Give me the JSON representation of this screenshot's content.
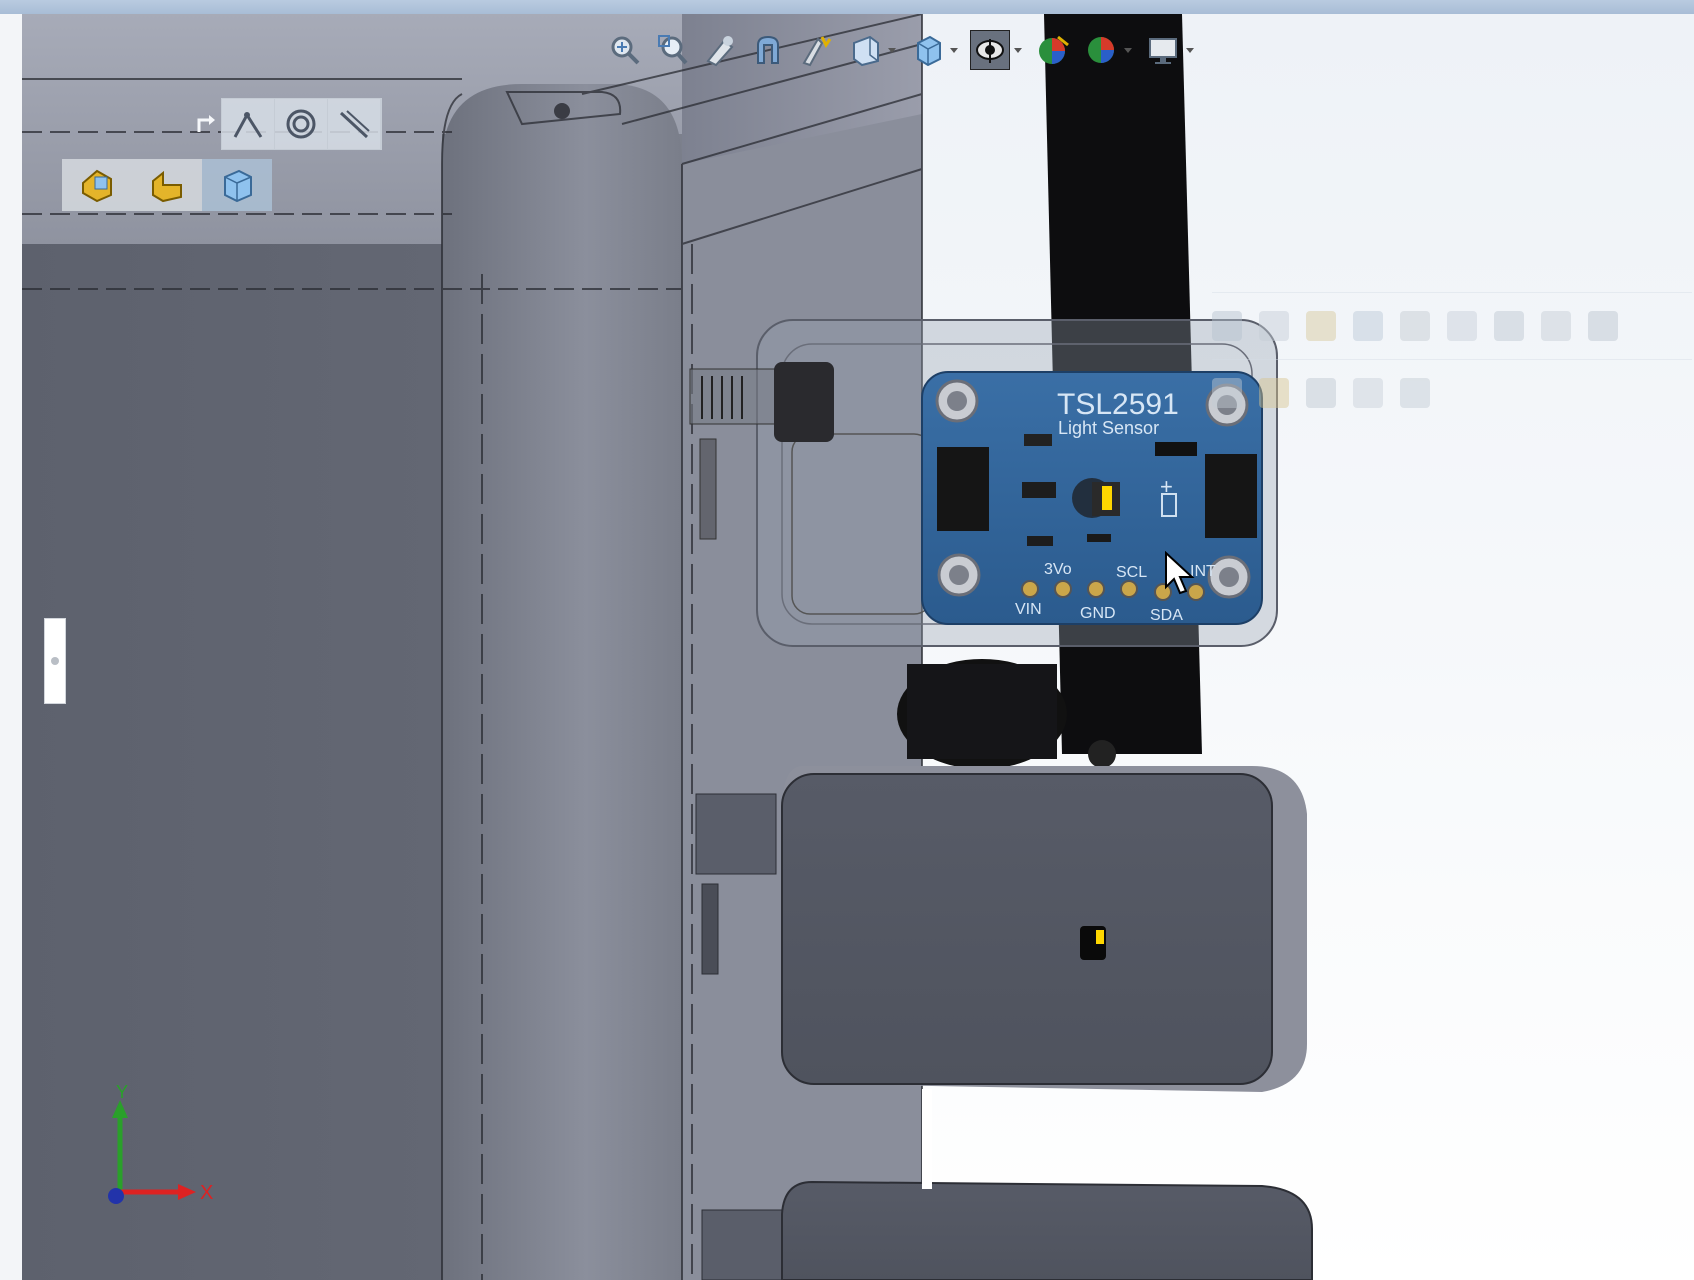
{
  "app": "SOLIDWORKS 3D viewport",
  "heads_up_toolbar": {
    "buttons": [
      {
        "name": "zoom-to-fit-icon"
      },
      {
        "name": "zoom-to-area-icon"
      },
      {
        "name": "previous-view-icon"
      },
      {
        "name": "section-view-icon"
      },
      {
        "name": "dynamic-annotation-icon"
      },
      {
        "name": "view-orientation-icon"
      },
      {
        "name": "display-style-icon"
      },
      {
        "name": "hide-show-items-icon"
      },
      {
        "name": "edit-appearance-icon"
      },
      {
        "name": "apply-scene-icon"
      },
      {
        "name": "view-settings-icon"
      }
    ]
  },
  "selection_filter": {
    "icons": [
      "vertex-icon",
      "edge-icon",
      "face-icon"
    ]
  },
  "filter_toolbar": {
    "icons": [
      "filter-parts-icon",
      "filter-features-icon",
      "filter-bodies-icon"
    ]
  },
  "pcb": {
    "title": "TSL2591",
    "subtitle": "Light Sensor",
    "labels": {
      "v": "3Vo",
      "scl": "SCL",
      "int": "INT",
      "vin": "VIN",
      "gnd": "GND",
      "sda": "SDA",
      "plus": "+"
    }
  },
  "triad": {
    "y": "Y",
    "x": "X"
  },
  "colors": {
    "pcb_blue": "#2b5b8e",
    "housing": "#5f6370",
    "accent": "#ffd700"
  }
}
